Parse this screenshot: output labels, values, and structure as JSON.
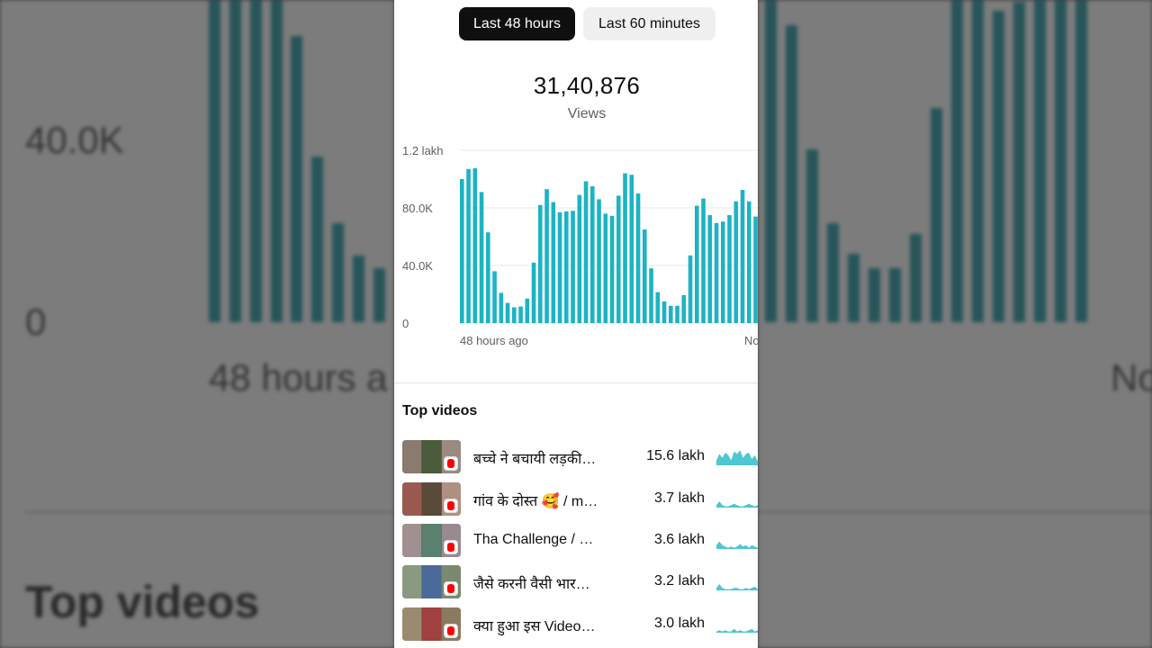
{
  "backdrop": {
    "left_tick_high": "40.0K",
    "left_tick_zero": "0",
    "left_axis_start": "48 hours a",
    "right_axis_end": "No",
    "left_section_title": "Top videos"
  },
  "time_filters": [
    {
      "label": "Last 48 hours",
      "selected": true
    },
    {
      "label": "Last 60 minutes",
      "selected": false
    }
  ],
  "summary": {
    "value": "31,40,876",
    "label": "Views"
  },
  "chart_data": {
    "type": "bar",
    "title": "",
    "xlabel": "",
    "ylabel": "",
    "ylim": [
      0,
      120000
    ],
    "y_ticks": [
      "0",
      "40.0K",
      "80.0K",
      "1.2 lakh"
    ],
    "x_labels": [
      "48 hours ago",
      "No"
    ],
    "grid": true,
    "bar_color": "#1db3c4",
    "values": [
      100000,
      107000,
      107500,
      91000,
      63000,
      36000,
      21000,
      14000,
      11000,
      11500,
      17000,
      42000,
      82000,
      93000,
      84000,
      77000,
      77500,
      78000,
      89000,
      98500,
      95000,
      86000,
      76000,
      74500,
      88500,
      104000,
      103000,
      90000,
      65000,
      38000,
      21500,
      15000,
      12000,
      12000,
      19500,
      47000,
      81500,
      86500,
      75000,
      69500,
      70500,
      75000,
      84500,
      92500,
      84500,
      74000
    ]
  },
  "top_videos": {
    "title": "Top videos",
    "items": [
      {
        "title": "बच्चे ने बचायी लड़की…",
        "views": "15.6 lakh",
        "spark": [
          4,
          9,
          6,
          10,
          8,
          4,
          11,
          9,
          12,
          6,
          9,
          10,
          5,
          8,
          3
        ]
      },
      {
        "title": "गांव के दोस्त 🥰 / m…",
        "views": "3.7 lakh",
        "spark": [
          2,
          5,
          2,
          1,
          1,
          2,
          3,
          2,
          1,
          1,
          2,
          3,
          2,
          1,
          2
        ]
      },
      {
        "title": "Tha Challenge / …",
        "views": "3.6 lakh",
        "spark": [
          3,
          6,
          3,
          2,
          1,
          2,
          1,
          2,
          4,
          2,
          3,
          1,
          3,
          2,
          1
        ]
      },
      {
        "title": "जैसे करनी वैसी भार…",
        "views": "3.2 lakh",
        "spark": [
          2,
          5,
          2,
          1,
          1,
          1,
          2,
          2,
          1,
          1,
          2,
          1,
          2,
          3,
          1
        ]
      },
      {
        "title": "क्या हुआ इस Video…",
        "views": "3.0 lakh",
        "spark": [
          1,
          2,
          1,
          2,
          1,
          1,
          3,
          1,
          2,
          1,
          1,
          2,
          3,
          1,
          2
        ]
      }
    ]
  },
  "colors": {
    "bar": "#1db3c4",
    "spark": "#4ec7d1",
    "chip_selected_bg": "#0f0f0f",
    "chip_bg": "#f0f0f0",
    "shorts_red": "#ff0000"
  }
}
